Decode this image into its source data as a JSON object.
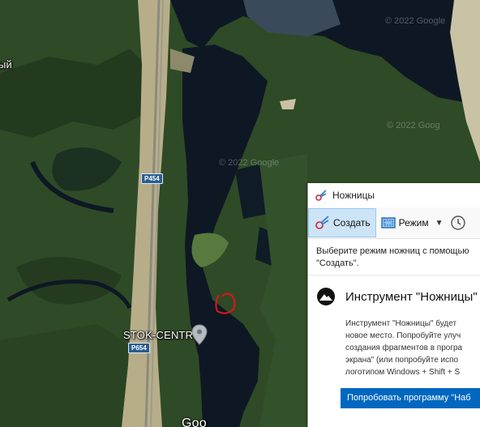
{
  "map": {
    "labels": {
      "left_partial": "ый",
      "road_p454": "P454",
      "road_p654": "P654",
      "place": "STOK-CENTR",
      "bottom_partial": "Goo"
    },
    "watermarks": [
      "© 2022 Google",
      "© 2022 Goog",
      "© 2022 Google"
    ],
    "icons": {
      "pin": "location-pin-icon"
    },
    "colors": {
      "water": "#0e1824",
      "land": "#2f4a26",
      "sand": "#c9c2a4",
      "annotation": "#e0141b"
    }
  },
  "snipping_tool": {
    "title": "Ножницы",
    "toolbar": {
      "new_label": "Создать",
      "mode_label": "Режим",
      "mode_dropdown": "▼"
    },
    "hint_line1": "Выберите режим ножниц с помощью",
    "hint_line2": "\"Создать\".",
    "notice": {
      "title": "Инструмент \"Ножницы\"",
      "lines": [
        "Инструмент \"Ножницы\" будет",
        "новое место. Попробуйте улуч",
        "создания фрагментов в програ",
        "экрана\" (или попробуйте испо",
        "логотипом Windows + Shift + S"
      ],
      "button_label": "Попробовать программу \"Наб"
    },
    "icons": [
      "scissors-icon",
      "new-snip-icon",
      "mode-icon",
      "delay-clock-icon",
      "notice-mountain-icon"
    ],
    "accent": "#0067c0"
  }
}
